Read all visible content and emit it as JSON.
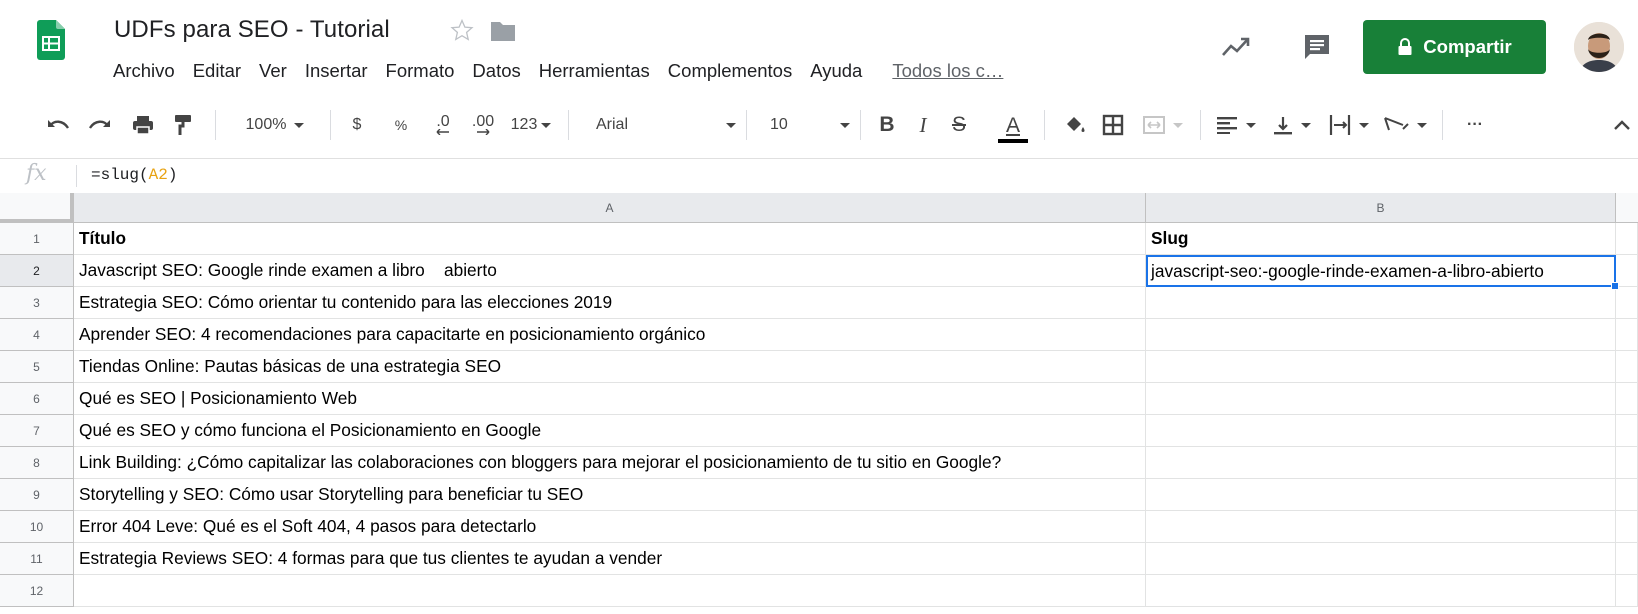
{
  "app": {
    "title": "UDFs para SEO - Tutorial",
    "share_label": "Compartir",
    "brand_color": "#188038",
    "selection_color": "#1a73e8"
  },
  "menu": {
    "items": [
      "Archivo",
      "Editar",
      "Ver",
      "Insertar",
      "Formato",
      "Datos",
      "Herramientas",
      "Complementos",
      "Ayuda"
    ],
    "last_edit": "Todos los c…"
  },
  "toolbar": {
    "zoom": "100%",
    "currency": "$",
    "percent": "%",
    "decrease_decimal": ".0",
    "increase_decimal": ".00",
    "more_formats": "123",
    "font": "Arial",
    "font_size": "10",
    "bold": "B",
    "italic": "I",
    "strike": "S",
    "text_color": "A",
    "more": "···"
  },
  "formula_bar": {
    "fx": "fx",
    "prefix": "=slug(",
    "ref": "A2",
    "suffix": ")"
  },
  "sheet": {
    "columns": [
      "A",
      "B"
    ],
    "row_numbers": [
      "1",
      "2",
      "3",
      "4",
      "5",
      "6",
      "7",
      "8",
      "9",
      "10",
      "11",
      "12"
    ],
    "active_cell": "B2",
    "rows": [
      [
        "Título",
        "Slug"
      ],
      [
        "Javascript SEO: Google rinde examen a libro    abierto",
        "javascript-seo:-google-rinde-examen-a-libro-abierto"
      ],
      [
        "Estrategia SEO: Cómo orientar tu contenido para las elecciones 2019",
        ""
      ],
      [
        "Aprender SEO: 4 recomendaciones para capacitarte en posicionamiento orgánico",
        ""
      ],
      [
        "Tiendas Online: Pautas básicas de una estrategia SEO",
        ""
      ],
      [
        "Qué es SEO | Posicionamiento Web",
        ""
      ],
      [
        "Qué es SEO y cómo funciona el Posicionamiento en Google",
        ""
      ],
      [
        "Link Building: ¿Cómo capitalizar las colaboraciones con bloggers para mejorar el posicionamiento de tu sitio en Google?",
        ""
      ],
      [
        "Storytelling y SEO: Cómo usar Storytelling para beneficiar tu SEO",
        ""
      ],
      [
        "Error 404 Leve: Qué es el Soft 404, 4 pasos para detectarlo",
        ""
      ],
      [
        "Estrategia Reviews SEO: 4 formas para que tus clientes te ayudan a vender",
        ""
      ],
      [
        "",
        ""
      ]
    ]
  }
}
